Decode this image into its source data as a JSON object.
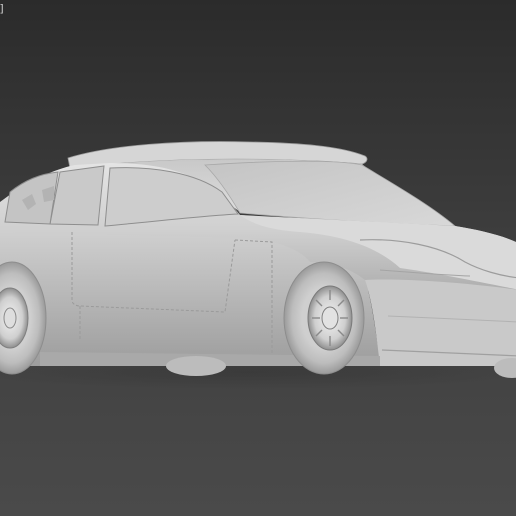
{
  "viewport": {
    "label": "g]",
    "object_name": "race-car-3d-model",
    "background_color": "#3a3a3a",
    "model_color": "#d9d9d9",
    "shading": "solid-gray"
  }
}
